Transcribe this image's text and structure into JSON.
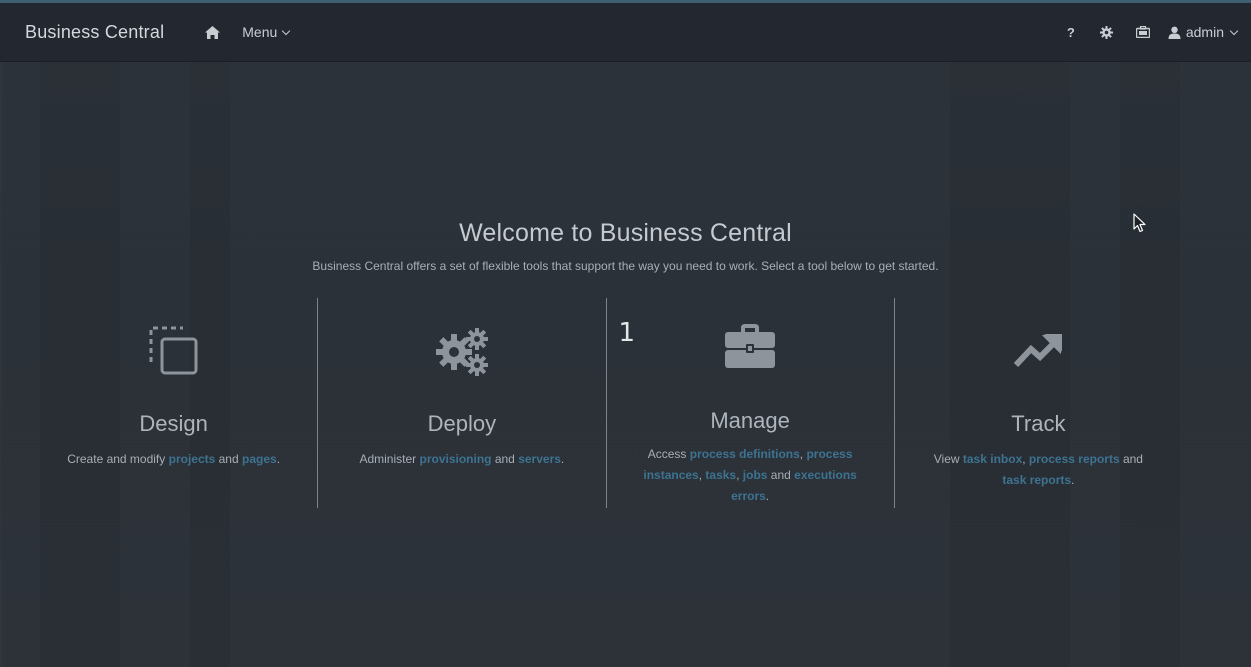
{
  "header": {
    "brand": "Business Central",
    "menu_label": "Menu",
    "help_label": "?",
    "user_label": "admin"
  },
  "welcome": {
    "title": "Welcome to Business Central",
    "subtitle": "Business Central offers a set of flexible tools that support the way you need to work. Select a tool below to get started."
  },
  "tools": {
    "design": {
      "title": "Design",
      "desc_1": "Create and modify ",
      "link_1": "projects",
      "desc_2": " and ",
      "link_2": "pages",
      "desc_3": "."
    },
    "deploy": {
      "title": "Deploy",
      "desc_1": "Administer ",
      "link_1": "provisioning",
      "desc_2": " and ",
      "link_2": "servers",
      "desc_3": "."
    },
    "manage": {
      "badge": "1",
      "title": "Manage",
      "desc_1": "Access ",
      "link_1": "process definitions",
      "sep_1": ", ",
      "link_2": "process instances",
      "sep_2": ", ",
      "link_3": "tasks",
      "sep_3": ", ",
      "link_4": "jobs",
      "sep_4": " and ",
      "link_5": "executions errors",
      "desc_end": "."
    },
    "track": {
      "title": "Track",
      "desc_1": "View ",
      "link_1": "task inbox",
      "sep_1": ", ",
      "link_2": "process reports",
      "sep_2": " and ",
      "link_3": "task reports",
      "desc_end": "."
    }
  },
  "colors": {
    "navbar": "#232830",
    "background": "#2b3138",
    "link": "#3d7391",
    "text": "#a8aeb5"
  },
  "icons": [
    "home-icon",
    "chevron-down-icon",
    "help-icon",
    "gear-icon",
    "briefcase-icon",
    "user-icon",
    "design-icon",
    "cogs-icon",
    "toolbox-icon",
    "trend-arrow-icon",
    "mouse-cursor-icon"
  ]
}
